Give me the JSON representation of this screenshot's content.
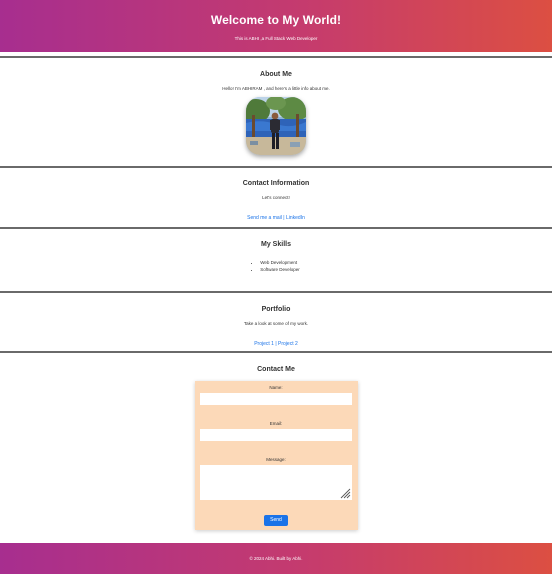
{
  "header": {
    "title": "Welcome to My World!",
    "subtitle": "This is ABHI ,a Full Stack Web Developer"
  },
  "about": {
    "heading": "About Me",
    "intro": "Hello! I'm ABHIRAM , and here's a little info about me."
  },
  "contact_info": {
    "heading": "Contact Information",
    "text": "Let's connect!",
    "mail_link": "Send me a mail",
    "separator": " | ",
    "linkedin_link": "LinkedIn"
  },
  "skills": {
    "heading": "My Skills",
    "items": [
      "Web Development",
      "Software Developer"
    ]
  },
  "portfolio": {
    "heading": "Portfolio",
    "text": "Take a look at some of my work.",
    "project1": "Project 1",
    "separator": " | ",
    "project2": "Project 2"
  },
  "contact_me": {
    "heading": "Contact Me",
    "name_label": "Name:",
    "email_label": "Email:",
    "message_label": "Message:",
    "send_label": "Send"
  },
  "footer": {
    "text": "© 2024 Abhi. Built by Abhi."
  }
}
